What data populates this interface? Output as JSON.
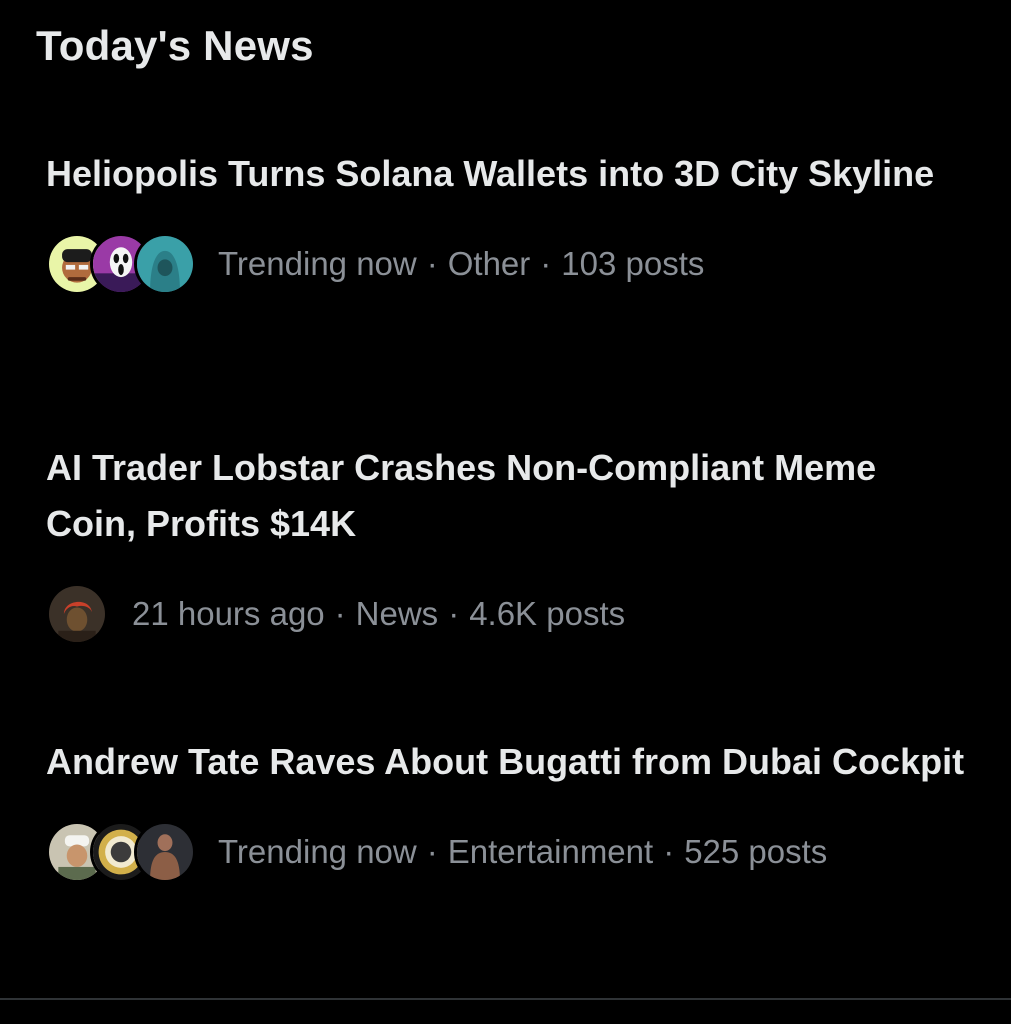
{
  "section": {
    "title": "Today's News"
  },
  "items": [
    {
      "headline": "Heliopolis Turns Solana Wallets into 3D City Skyline",
      "time": "Trending now",
      "category": "Other",
      "posts": "103 posts",
      "avatars": [
        "cartoon-avatar-icon",
        "ghostface-avatar-icon",
        "hooded-figure-avatar-icon"
      ]
    },
    {
      "headline": "AI Trader Lobstar Crashes Non-Compliant Meme Coin, Profits $14K",
      "time": "21 hours ago",
      "category": "News",
      "posts": "4.6K posts",
      "avatars": [
        "red-hair-avatar-icon"
      ]
    },
    {
      "headline": "Andrew Tate Raves About Bugatti from Dubai Cockpit",
      "time": "Trending now",
      "category": "Entertainment",
      "posts": "525 posts",
      "avatars": [
        "man-white-cap-avatar-icon",
        "gold-seal-avatar-icon",
        "shirtless-man-avatar-icon"
      ]
    }
  ],
  "separator": "·",
  "colors": {
    "background": "#000000",
    "primary_text": "#e7e9ea",
    "secondary_text": "#8b9097",
    "divider": "#2f3336"
  }
}
